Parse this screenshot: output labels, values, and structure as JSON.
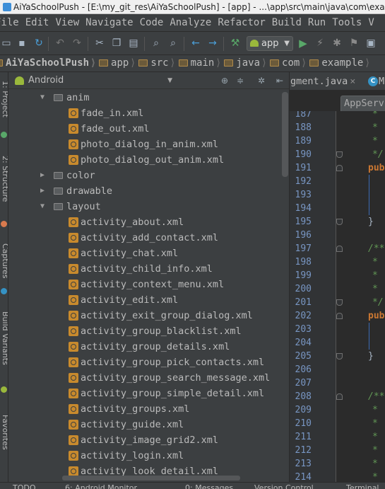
{
  "window": {
    "title": "AiYaSchoolPush - [E:\\my_git_res\\AiYaSchoolPush] - [app] - ...\\app\\src\\main\\java\\com\\example"
  },
  "menu": [
    "File",
    "Edit",
    "View",
    "Navigate",
    "Code",
    "Analyze",
    "Refactor",
    "Build",
    "Run",
    "Tools",
    "V"
  ],
  "toolbar": {
    "run_config": "app"
  },
  "breadcrumbs": [
    "AiYaSchoolPush",
    "app",
    "src",
    "main",
    "java",
    "com",
    "example"
  ],
  "left_strip": [
    "1: Project",
    "2: Structure",
    "Captures",
    "Build Variants",
    "Favorites"
  ],
  "project_panel": {
    "view_mode": "Android",
    "tree": [
      {
        "label": "anim",
        "kind": "folder",
        "expanded": true,
        "level": 0
      },
      {
        "label": "fade_in.xml",
        "kind": "xml",
        "level": 1
      },
      {
        "label": "fade_out.xml",
        "kind": "xml",
        "level": 1
      },
      {
        "label": "photo_dialog_in_anim.xml",
        "kind": "xml",
        "level": 1
      },
      {
        "label": "photo_dialog_out_anim.xml",
        "kind": "xml",
        "level": 1
      },
      {
        "label": "color",
        "kind": "folder",
        "expanded": false,
        "level": 0
      },
      {
        "label": "drawable",
        "kind": "folder",
        "expanded": false,
        "level": 0
      },
      {
        "label": "layout",
        "kind": "folder",
        "expanded": true,
        "level": 0
      },
      {
        "label": "activity_about.xml",
        "kind": "xml",
        "level": 1
      },
      {
        "label": "activity_add_contact.xml",
        "kind": "xml",
        "level": 1
      },
      {
        "label": "activity_chat.xml",
        "kind": "xml",
        "level": 1
      },
      {
        "label": "activity_child_info.xml",
        "kind": "xml",
        "level": 1
      },
      {
        "label": "activity_context_menu.xml",
        "kind": "xml",
        "level": 1
      },
      {
        "label": "activity_edit.xml",
        "kind": "xml",
        "level": 1
      },
      {
        "label": "activity_exit_group_dialog.xml",
        "kind": "xml",
        "level": 1
      },
      {
        "label": "activity_group_blacklist.xml",
        "kind": "xml",
        "level": 1
      },
      {
        "label": "activity_group_details.xml",
        "kind": "xml",
        "level": 1
      },
      {
        "label": "activity_group_pick_contacts.xml",
        "kind": "xml",
        "level": 1
      },
      {
        "label": "activity_group_search_message.xml",
        "kind": "xml",
        "level": 1
      },
      {
        "label": "activity_group_simple_detail.xml",
        "kind": "xml",
        "level": 1
      },
      {
        "label": "activity_groups.xml",
        "kind": "xml",
        "level": 1
      },
      {
        "label": "activity_guide.xml",
        "kind": "xml",
        "level": 1
      },
      {
        "label": "activity_image_grid2.xml",
        "kind": "xml",
        "level": 1
      },
      {
        "label": "activity_login.xml",
        "kind": "xml",
        "level": 1
      },
      {
        "label": "activity_look_detail.xml",
        "kind": "xml",
        "level": 1
      }
    ]
  },
  "editor": {
    "tabs": [
      {
        "label": "gment.java",
        "close": "×"
      },
      {
        "label": "M",
        "icon": "C"
      }
    ],
    "secondary_tab": "AppServ",
    "line_numbers": [
      "187",
      "188",
      "189",
      "190",
      "191",
      "192",
      "193",
      "194",
      "195",
      "196",
      "197",
      "198",
      "199",
      "200",
      "201",
      "202",
      "203",
      "204",
      "205",
      "206",
      "207",
      "208",
      "209",
      "210",
      "211",
      "212",
      "213",
      "214"
    ],
    "code_lines": [
      {
        "text": "*",
        "cls": "cmt"
      },
      {
        "text": "*",
        "cls": "cmt"
      },
      {
        "text": "*",
        "cls": "cmt"
      },
      {
        "text": "*/",
        "cls": "cmt"
      },
      {
        "text": "pub",
        "cls": "kw"
      },
      {
        "text": "",
        "cls": "txt"
      },
      {
        "text": "",
        "cls": "txt"
      },
      {
        "text": "",
        "cls": "txt"
      },
      {
        "text": "}",
        "cls": "txt"
      },
      {
        "text": "",
        "cls": "txt"
      },
      {
        "text": "/**",
        "cls": "cmt"
      },
      {
        "text": "*",
        "cls": "cmt"
      },
      {
        "text": "*",
        "cls": "cmt"
      },
      {
        "text": "*",
        "cls": "cmt"
      },
      {
        "text": "*/",
        "cls": "cmt"
      },
      {
        "text": "pub",
        "cls": "kw"
      },
      {
        "text": "",
        "cls": "txt"
      },
      {
        "text": "",
        "cls": "txt"
      },
      {
        "text": "}",
        "cls": "txt"
      },
      {
        "text": "",
        "cls": "txt"
      },
      {
        "text": "",
        "cls": "txt"
      },
      {
        "text": "/**",
        "cls": "cmt"
      },
      {
        "text": "*",
        "cls": "cmt"
      },
      {
        "text": "*",
        "cls": "cmt"
      },
      {
        "text": "*",
        "cls": "cmt"
      },
      {
        "text": "*",
        "cls": "cmt"
      },
      {
        "text": "*",
        "cls": "cmt"
      },
      {
        "text": "*",
        "cls": "cmt"
      }
    ]
  },
  "statusbar": [
    "TODO",
    "6: Android Monitor",
    "0: Messages",
    "Version Control",
    "Terminal"
  ],
  "colors": {
    "background": "#3c3f41",
    "editor_bg": "#2b2b2b",
    "line_number": "#7896c3",
    "comment": "#629755",
    "keyword": "#cc7832"
  }
}
